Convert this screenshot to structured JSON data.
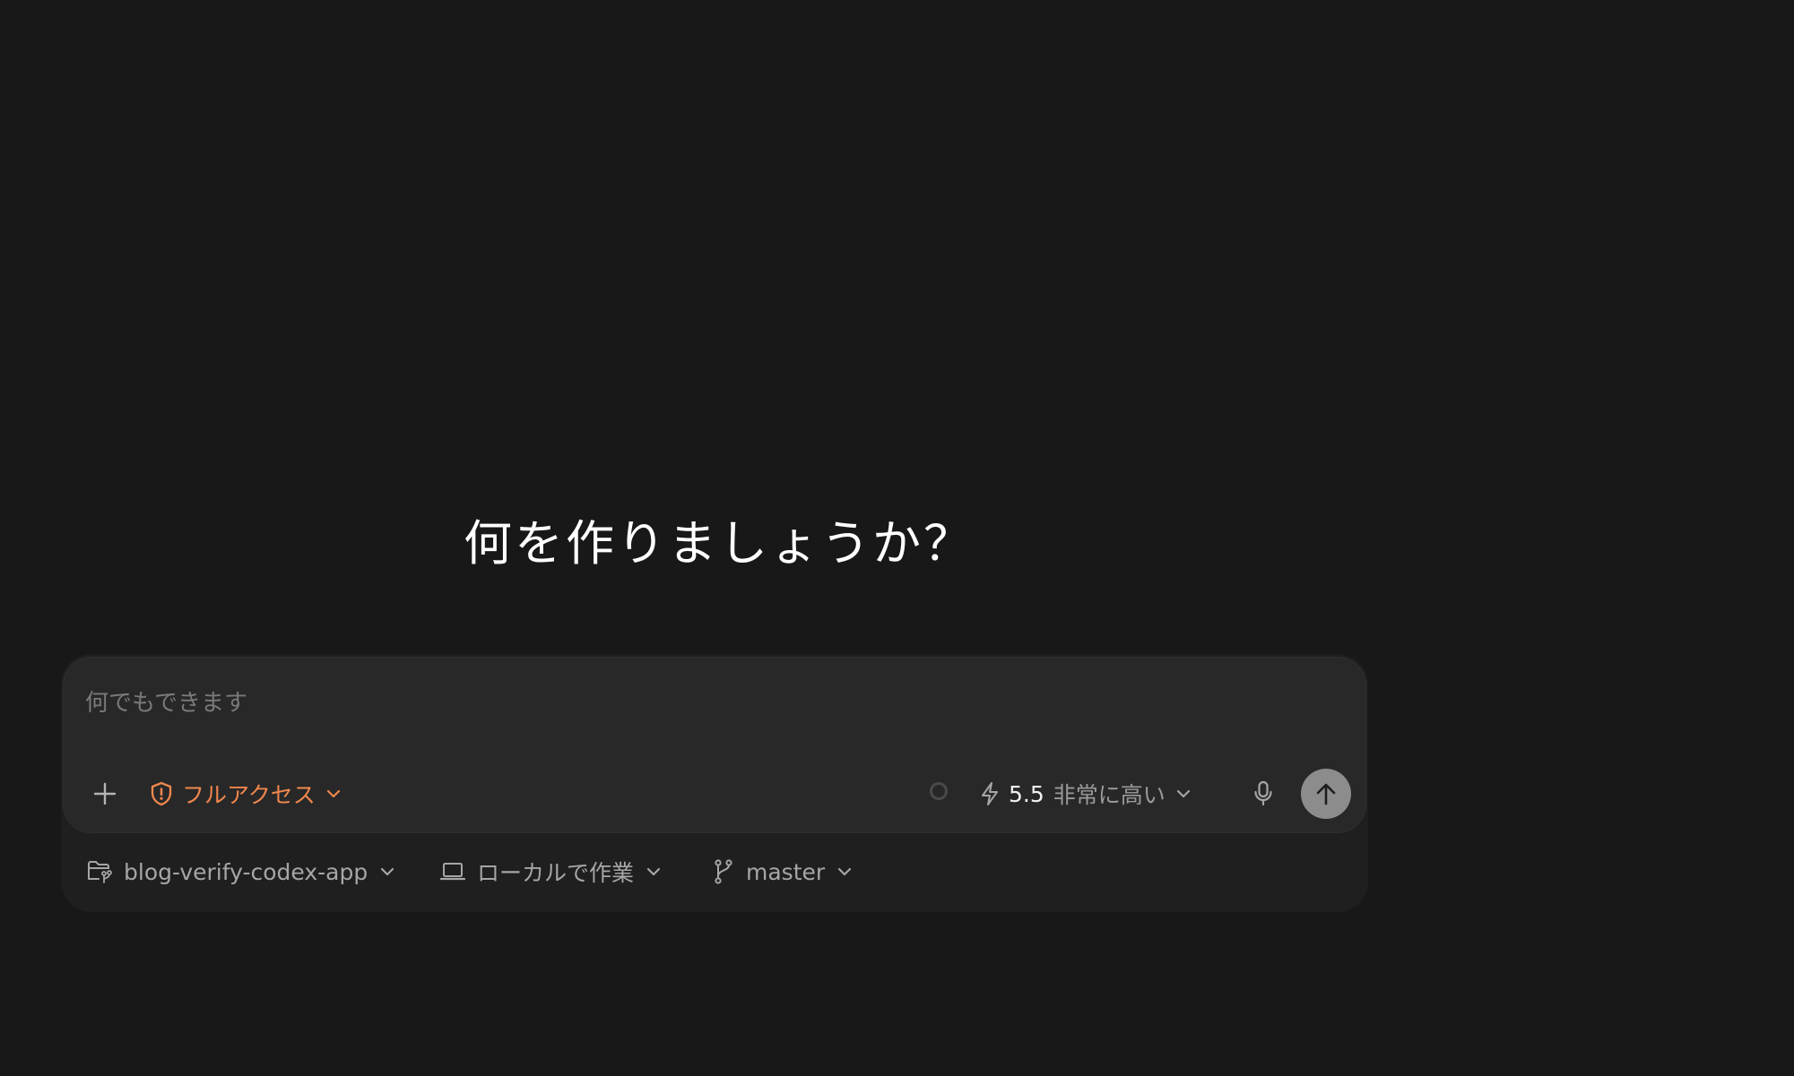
{
  "heading": "何を作りましょうか？",
  "composer": {
    "input_value": "",
    "placeholder": "何でもできます",
    "access_label": "フルアクセス",
    "model_version": "5.5",
    "model_effort": "非常に高い"
  },
  "footer": {
    "project": "blog-verify-codex-app",
    "environment": "ローカルで作業",
    "branch": "master"
  },
  "icons": {
    "add": "plus-icon",
    "access": "shield-alert-icon",
    "status": "status-ring-icon",
    "model": "lightning-icon",
    "mic": "microphone-icon",
    "send": "arrow-up-icon",
    "project": "folder-git-icon",
    "environment": "laptop-icon",
    "branch": "git-branch-icon"
  },
  "colors": {
    "background": "#181818",
    "composer": "#282828",
    "accent_orange": "#f0874d",
    "send_button": "#8c8c8c"
  }
}
